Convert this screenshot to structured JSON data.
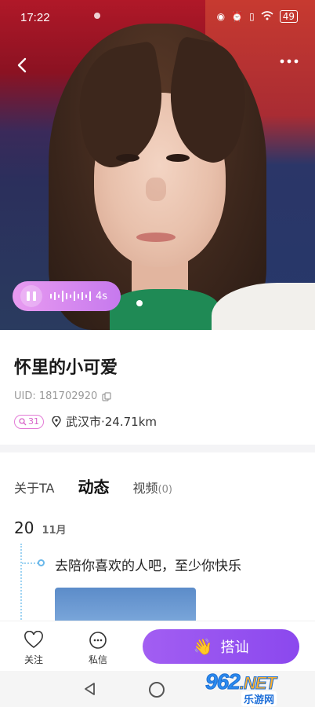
{
  "status_bar": {
    "time": "17:22",
    "battery": "49"
  },
  "hero": {
    "voice_duration": "4s",
    "page_indicator": 1
  },
  "profile": {
    "name": "怀里的小可爱",
    "uid": "UID: 181702920",
    "level": "31",
    "location": "武汉市·24.71km"
  },
  "tabs": [
    {
      "label": "关于TA"
    },
    {
      "label": "动态"
    },
    {
      "label": "视频",
      "count": "(0)"
    }
  ],
  "moment": {
    "day": "20",
    "month": "11月",
    "text": "去陪你喜欢的人吧，至少你快乐"
  },
  "actions": {
    "follow": "关注",
    "message": "私信",
    "greet": "搭讪"
  },
  "watermark": {
    "num": "962",
    "suffix": ".NET",
    "cn": "乐游网"
  },
  "colors": {
    "accent": "#9a55f0",
    "voice": "#d88af0",
    "level": "#d764c9"
  }
}
